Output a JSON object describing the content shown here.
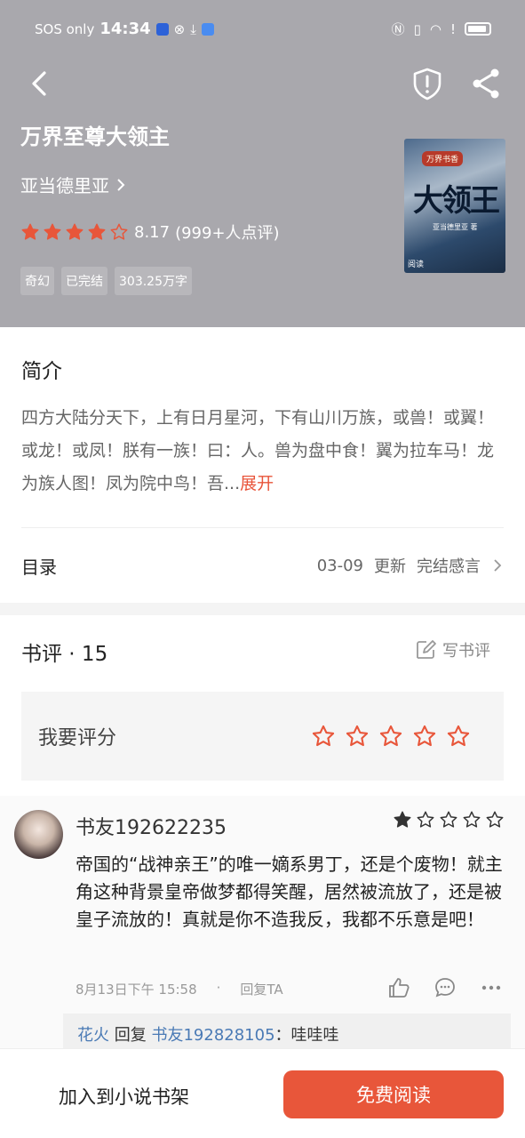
{
  "status_bar": {
    "carrier": "SOS only",
    "time": "14:34"
  },
  "book": {
    "title": "万界至尊大领主",
    "author": "亚当德里亚",
    "rating_value": "8.17",
    "rating_count": "(999+人点评)",
    "rating_stars": 4,
    "tags": [
      "奇幻",
      "已完结",
      "303.25万字"
    ],
    "cover": {
      "badge": "万界书香",
      "title": "大领王",
      "subtitle": "亚当德里亚 著",
      "publisher": "阅读"
    }
  },
  "intro": {
    "heading": "简介",
    "text": "四方大陆分天下，上有日月星河，下有山川万族，或兽！或翼！或龙！或凤！朕有一族！曰：人。兽为盘中食！翼为拉车马！龙为族人图！凤为院中鸟！吾...",
    "expand": "展开"
  },
  "toc": {
    "label": "目录",
    "date": "03-09",
    "update": "更新",
    "latest_chapter": "完结感言"
  },
  "reviews": {
    "heading": "书评 · 15",
    "write_label": "写书评",
    "rate_prompt": "我要评分"
  },
  "comment": {
    "user": "书友192622235",
    "stars": 1,
    "text": "帝国的“战神亲王”的唯一嫡系男丁，还是个废物！就主角这种背景皇帝做梦都得笑醒，居然被流放了，还是被皇子流放的！真就是你不造我反，我都不乐意是吧！",
    "time": "8月13日下午 15:58",
    "separator": "·",
    "reply_label": "回复TA",
    "reply": {
      "from": "花火",
      "verb": "回复",
      "to": "书友192828105",
      "text": "：哇哇哇"
    }
  },
  "bottom": {
    "add_shelf": "加入到小说书架",
    "read": "免费阅读"
  },
  "colors": {
    "header_bg": "#a9a8ad",
    "accent": "#e8563a",
    "reply_user": "#4a7ab5"
  }
}
